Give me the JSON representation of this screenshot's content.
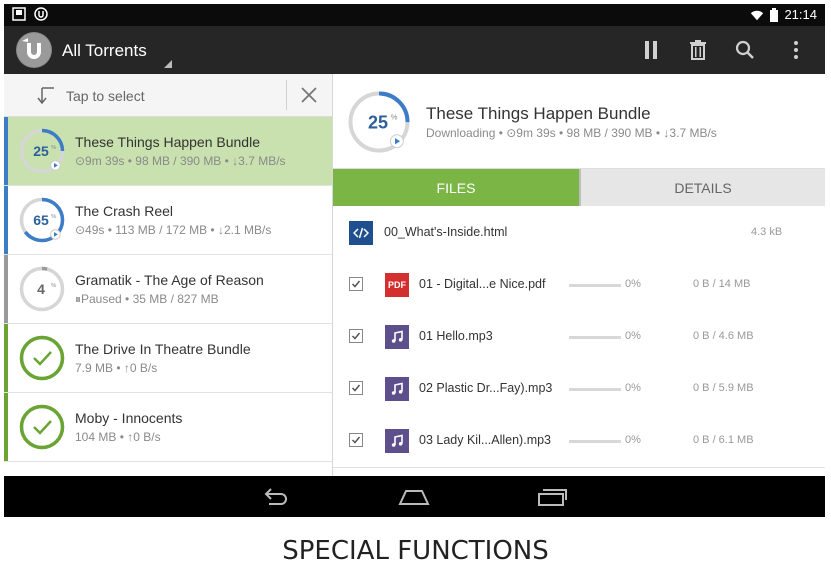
{
  "status_bar": {
    "time": "21:14"
  },
  "action_bar": {
    "title": "All Torrents"
  },
  "select_bar": {
    "label": "Tap to select"
  },
  "torrents": [
    {
      "progress": "25",
      "name": "These Things Happen Bundle",
      "meta": "⊙9m 39s • 98 MB / 390 MB • ↓3.7 MB/s",
      "state": "downloading",
      "active": true
    },
    {
      "progress": "65",
      "name": "The Crash Reel",
      "meta": "⊙49s • 113 MB / 172 MB • ↓2.1 MB/s",
      "state": "downloading",
      "active": false
    },
    {
      "progress": "4",
      "name": "Gramatik - The Age of Reason",
      "meta": "⏸Paused • 35 MB / 827 MB",
      "state": "paused",
      "active": false
    },
    {
      "progress": "100",
      "name": "The Drive In Theatre Bundle",
      "meta": "7.9 MB • ↑0 B/s",
      "state": "complete",
      "active": false
    },
    {
      "progress": "100",
      "name": "Moby - Innocents",
      "meta": "104 MB • ↑0 B/s",
      "state": "complete",
      "active": false
    }
  ],
  "detail": {
    "progress": "25",
    "name": "These Things Happen Bundle",
    "meta": "Downloading • ⊙9m 39s • 98 MB / 390 MB • ↓3.7 MB/s"
  },
  "tabs": {
    "files": "FILES",
    "details": "DETAILS"
  },
  "files": [
    {
      "type": "html",
      "name": "00_What's-Inside.html",
      "size": "4.3 kB",
      "checkbox": false
    },
    {
      "type": "pdf",
      "icon_label": "PDF",
      "name": "01 - Digital...e Nice.pdf",
      "percent": "0%",
      "size": "0 B / 14 MB",
      "checkbox": true
    },
    {
      "type": "audio",
      "name": "01 Hello.mp3",
      "percent": "0%",
      "size": "0 B / 4.6 MB",
      "checkbox": true
    },
    {
      "type": "audio",
      "name": "02 Plastic Dr...Fay).mp3",
      "percent": "0%",
      "size": "0 B / 5.9 MB",
      "checkbox": true
    },
    {
      "type": "audio",
      "name": "03 Lady Kil...Allen).mp3",
      "percent": "0%",
      "size": "0 B / 6.1 MB",
      "checkbox": true
    }
  ],
  "caption": "SPECIAL FUNCTIONS",
  "colors": {
    "accent_green": "#7bb545",
    "active_row": "#c8e1ae",
    "progress_blue": "#3d7dc8",
    "complete_green": "#6aa534",
    "paused_grey": "#9a9a9a",
    "pdf_red": "#d32f2f",
    "audio_purple": "#5c4f8c",
    "html_blue": "#1f4f8f"
  }
}
